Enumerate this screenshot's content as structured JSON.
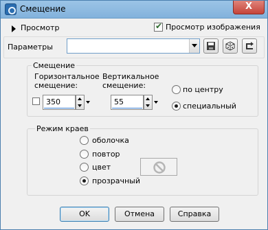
{
  "window": {
    "title": "Смещение",
    "close_label": "X"
  },
  "preview": {
    "toggle_label": "Просмотр",
    "image_preview_label": "Просмотр изображения",
    "image_preview_checked": true
  },
  "params": {
    "label": "Параметры",
    "value": ""
  },
  "offset": {
    "group_title": "Смещение",
    "horizontal_label_1": "Горизонтальное",
    "horizontal_label_2": "смещение:",
    "vertical_label_1": "Вертикальное",
    "vertical_label_2": "смещение:",
    "horizontal_value": "350",
    "vertical_value": "55",
    "center_label": "по центру",
    "custom_label": "специальный",
    "selected": "специальный"
  },
  "edge": {
    "group_title": "Режим краев",
    "options": [
      "оболочка",
      "повтор",
      "цвет",
      "прозрачный"
    ],
    "selected": "прозрачный"
  },
  "buttons": {
    "ok": "OK",
    "cancel": "Отмена",
    "help": "Справка"
  },
  "icons": {
    "title": "app-icon",
    "save": "save-icon",
    "random": "dice-icon",
    "reset": "reset-icon",
    "disabled": "disabled-color-icon"
  }
}
